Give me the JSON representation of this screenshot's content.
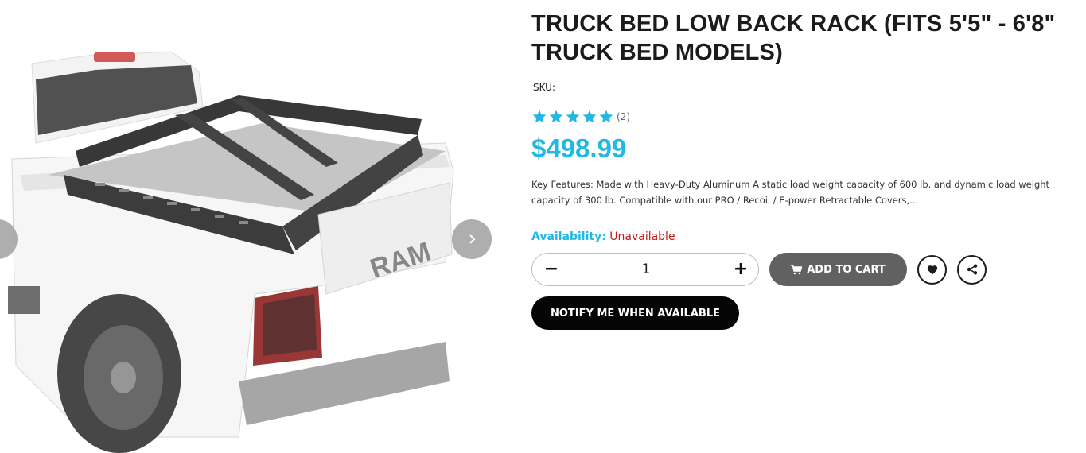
{
  "gallery": {
    "image_alt": "Truck bed low back rack mounted on a white pickup truck",
    "prev_icon": "chevron-left-icon",
    "next_icon": "chevron-right-icon"
  },
  "product": {
    "title": "TRUCK BED LOW BACK RACK (FITS 5'5\" - 6'8\" TRUCK BED MODELS)",
    "sku_label": "SKU:",
    "sku_value": "",
    "rating": 5,
    "review_count": "(2)",
    "price": "$498.99",
    "description": "Key Features: Made with Heavy-Duty Aluminum  A static load weight capacity of 600 lb. and dynamic load weight capacity of 300 lb. Compatible with our PRO / Recoil / E-power Retractable Covers,...",
    "availability_label": "Availability:",
    "availability_value": "Unavailable"
  },
  "purchase": {
    "minus_label": "−",
    "quantity": "1",
    "plus_label": "+",
    "add_to_cart_label": "ADD TO CART",
    "notify_label": "NOTIFY ME WHEN AVAILABLE"
  },
  "colors": {
    "accent": "#22b8e4",
    "unavailable": "#c41a1a",
    "cart_button": "#616161",
    "notify_button": "#050505"
  }
}
